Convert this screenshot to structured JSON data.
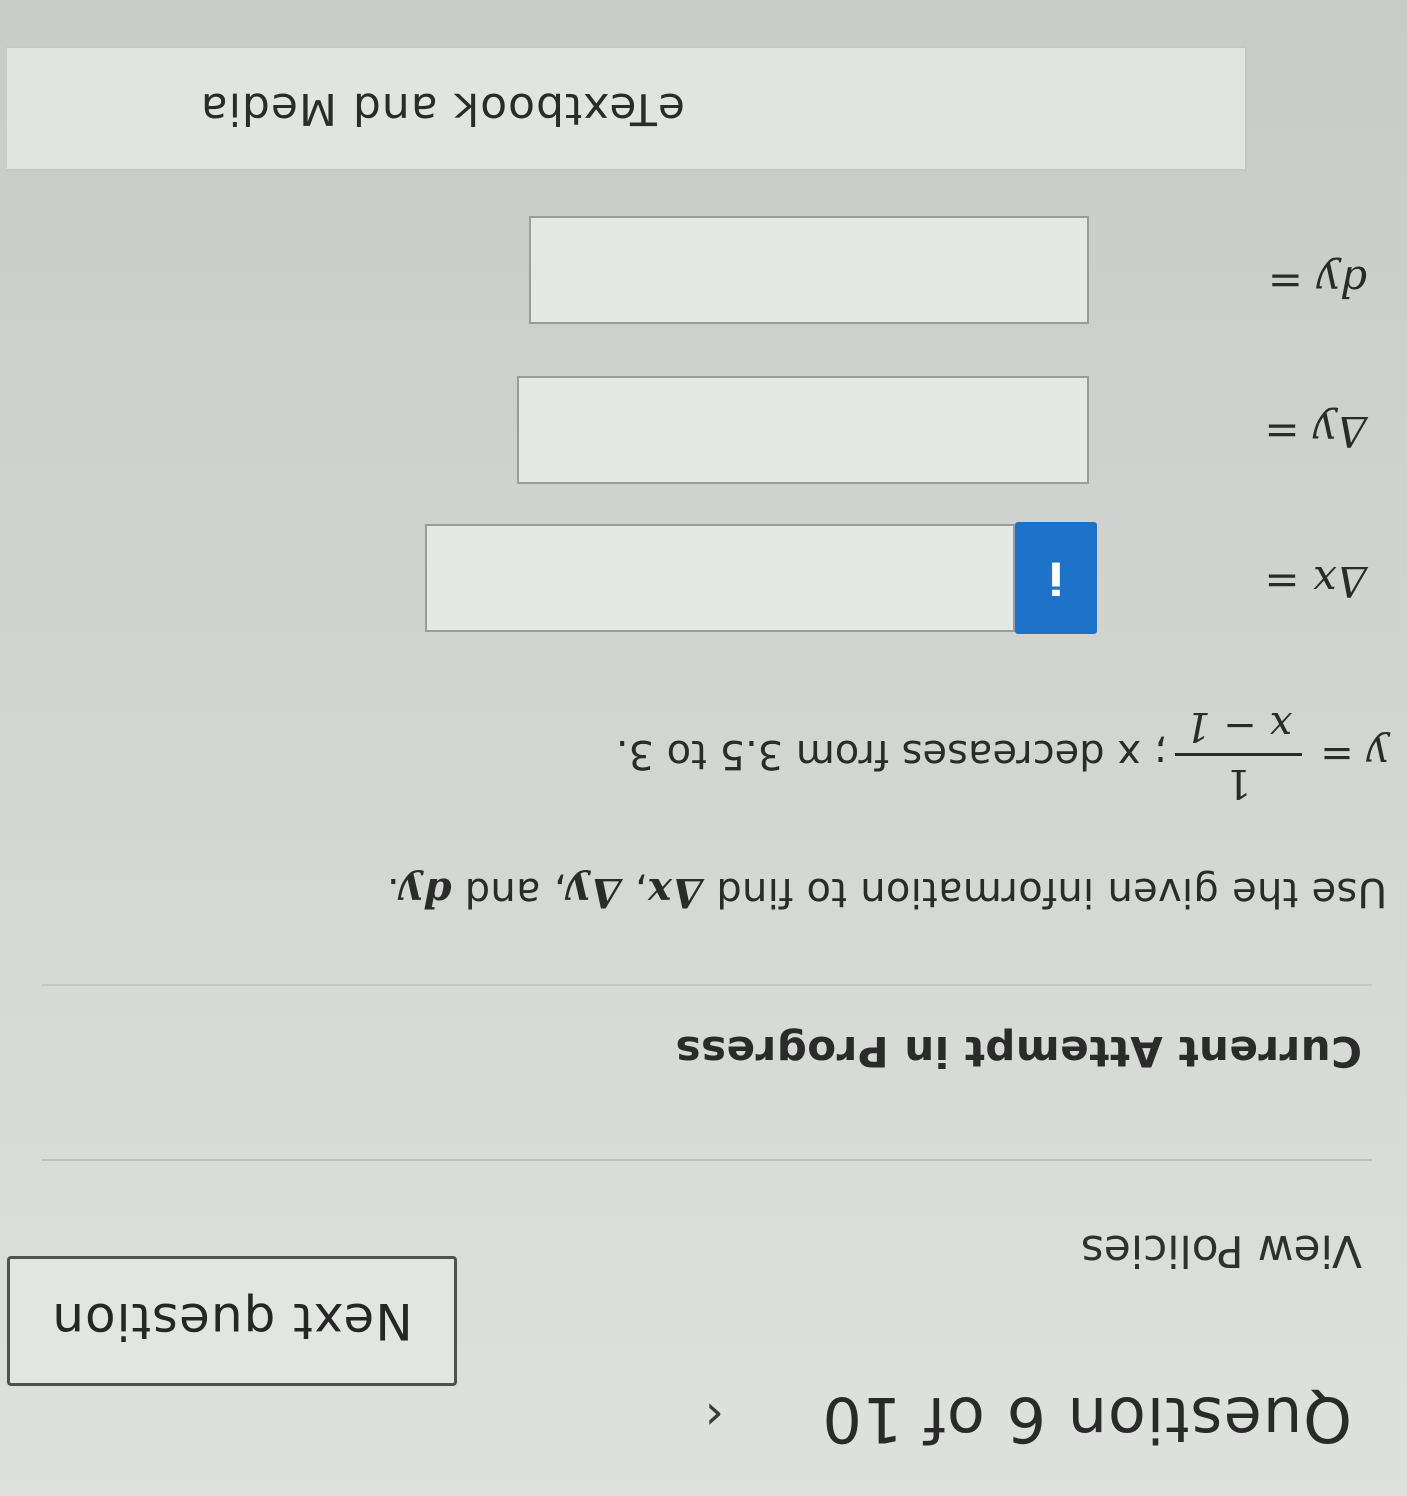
{
  "header": {
    "question_label": "Question 6 of 10",
    "prev_icon": "chevron-left-icon",
    "next_label": "Next question"
  },
  "links": {
    "view_policies": "View Policies"
  },
  "status": {
    "attempt": "Current Attempt in Progress"
  },
  "problem": {
    "instruction_prefix": "Use the given information to find ",
    "dx": "Δx",
    "sep1": ",  ",
    "dy_delta": "Δy",
    "sep2": ",  and ",
    "dy_diff": "dy",
    "period": ".",
    "y_equals": "y =",
    "fraction_num": "1",
    "fraction_den": "x − 1",
    "condition": "; x decreases from 3.5 to 3."
  },
  "answers": [
    {
      "label": "Δx =",
      "value": "",
      "has_info": true,
      "info_label": "i"
    },
    {
      "label": "Δy =",
      "value": "",
      "has_info": false
    },
    {
      "label": "dy =",
      "value": "",
      "has_info": false
    }
  ],
  "resources": {
    "media_label": "eTextbook and Media"
  }
}
